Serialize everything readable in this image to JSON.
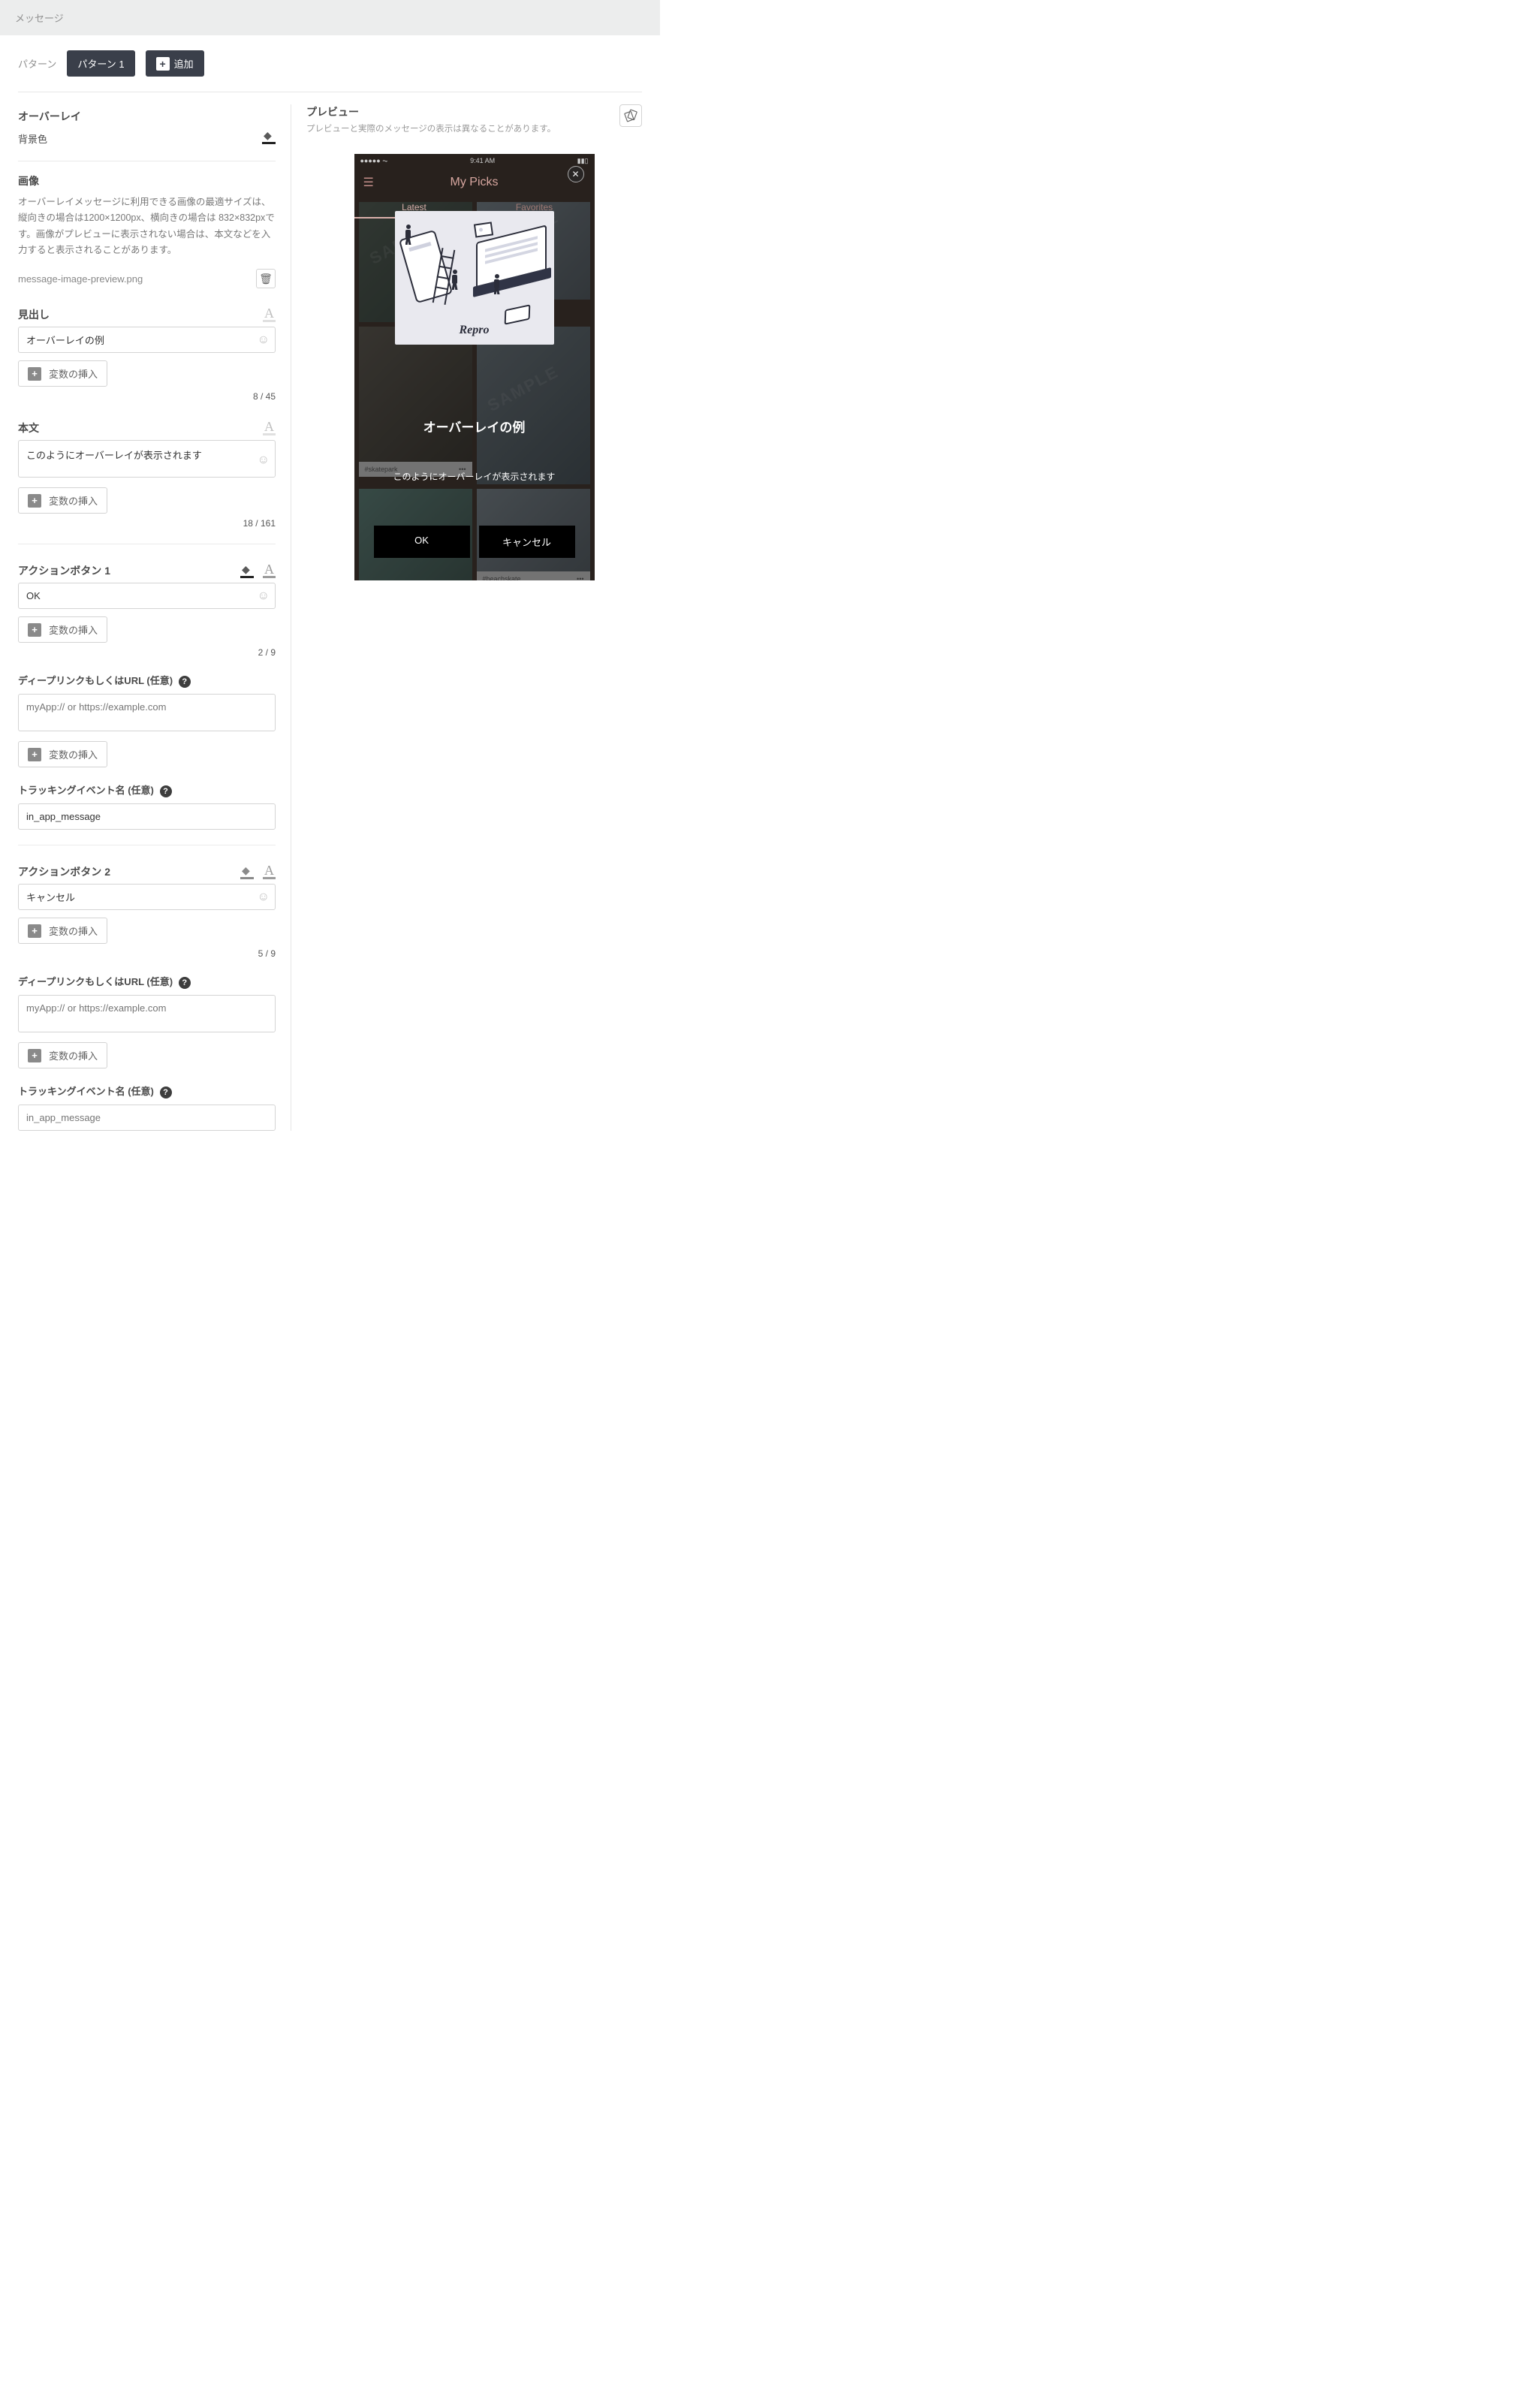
{
  "titleBar": "メッセージ",
  "pattern": {
    "label": "パターン",
    "tab1": "パターン 1",
    "add": "追加"
  },
  "overlay": {
    "title": "オーバーレイ",
    "bgColorLabel": "背景色"
  },
  "image": {
    "title": "画像",
    "desc": "オーバーレイメッセージに利用できる画像の最適サイズは、縦向きの場合は1200×1200px、横向きの場合は 832×832pxです。画像がプレビューに表示されない場合は、本文などを入力すると表示されることがあります。",
    "file": "message-image-preview.png"
  },
  "heading": {
    "label": "見出し",
    "value": "オーバーレイの例",
    "insertVar": "変数の挿入",
    "count": "8 / 45"
  },
  "body": {
    "label": "本文",
    "value": "このようにオーバーレイが表示されます",
    "insertVar": "変数の挿入",
    "count": "18 / 161"
  },
  "action1": {
    "label": "アクションボタン 1",
    "value": "OK",
    "insertVar": "変数の挿入",
    "count": "2 / 9",
    "deepLabel": "ディープリンクもしくはURL (任意)",
    "deepPlaceholder": "myApp:// or https://example.com",
    "trackLabel": "トラッキングイベント名 (任意)",
    "trackValue": "in_app_message"
  },
  "action2": {
    "label": "アクションボタン 2",
    "value": "キャンセル",
    "insertVar": "変数の挿入",
    "count": "5 / 9",
    "deepLabel": "ディープリンクもしくはURL (任意)",
    "deepPlaceholder": "myApp:// or https://example.com",
    "trackLabel": "トラッキングイベント名 (任意)",
    "trackPlaceholder": "in_app_message"
  },
  "preview": {
    "title": "プレビュー",
    "note": "プレビューと実際のメッセージの表示は異なることがあります。",
    "appTitle": "My Picks",
    "statusTime": "9:41 AM",
    "tabLatest": "Latest",
    "tabFav": "Favorites",
    "tagSkate": "#skatepark",
    "tagBeach": "#beachskate",
    "brand": "Repro",
    "ovTitle": "オーバーレイの例",
    "ovBody": "このようにオーバーレイが表示されます",
    "btnOk": "OK",
    "btnCancel": "キャンセル"
  }
}
